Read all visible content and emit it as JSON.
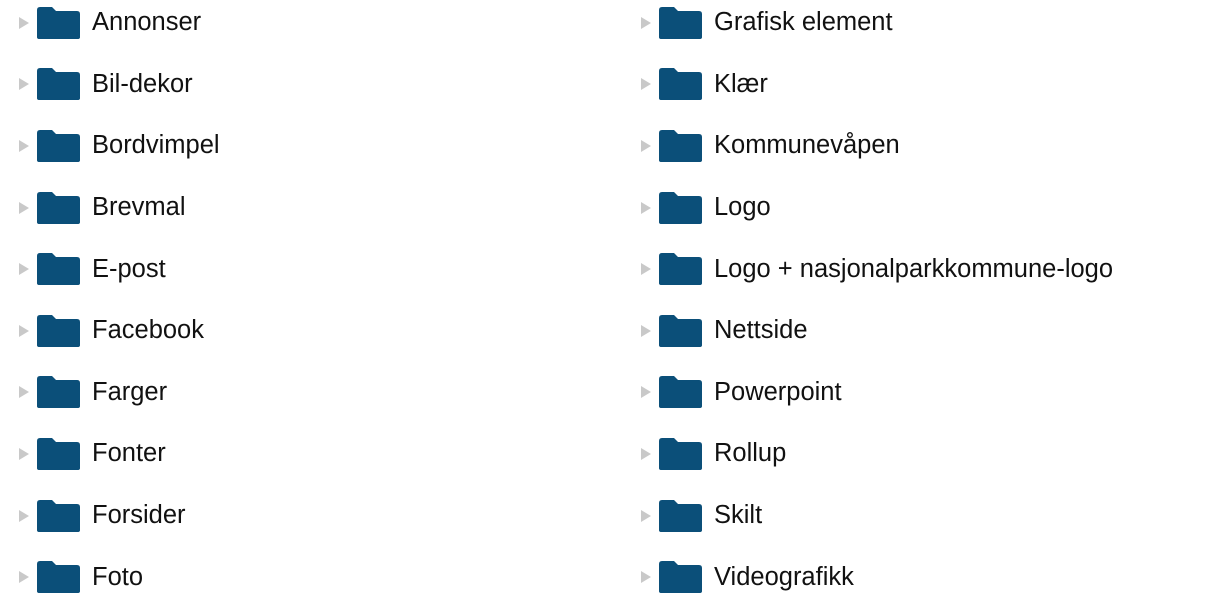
{
  "colors": {
    "folder": "#0b4f79",
    "folder_tab": "#0b4f79",
    "caret": "#c9c9c9",
    "text": "#111111"
  },
  "icons": {
    "expander": "caret-right-icon",
    "folder": "folder-icon"
  },
  "folders_left": [
    {
      "label": "Annonser"
    },
    {
      "label": "Bil-dekor"
    },
    {
      "label": "Bordvimpel"
    },
    {
      "label": "Brevmal"
    },
    {
      "label": "E-post"
    },
    {
      "label": "Facebook"
    },
    {
      "label": "Farger"
    },
    {
      "label": "Fonter"
    },
    {
      "label": "Forsider"
    },
    {
      "label": "Foto"
    }
  ],
  "folders_right": [
    {
      "label": "Grafisk element"
    },
    {
      "label": "Klær"
    },
    {
      "label": "Kommunevåpen"
    },
    {
      "label": "Logo"
    },
    {
      "label": "Logo + nasjonalparkkommune-logo"
    },
    {
      "label": "Nettside"
    },
    {
      "label": "Powerpoint"
    },
    {
      "label": "Rollup"
    },
    {
      "label": "Skilt"
    },
    {
      "label": "Videografikk"
    }
  ]
}
